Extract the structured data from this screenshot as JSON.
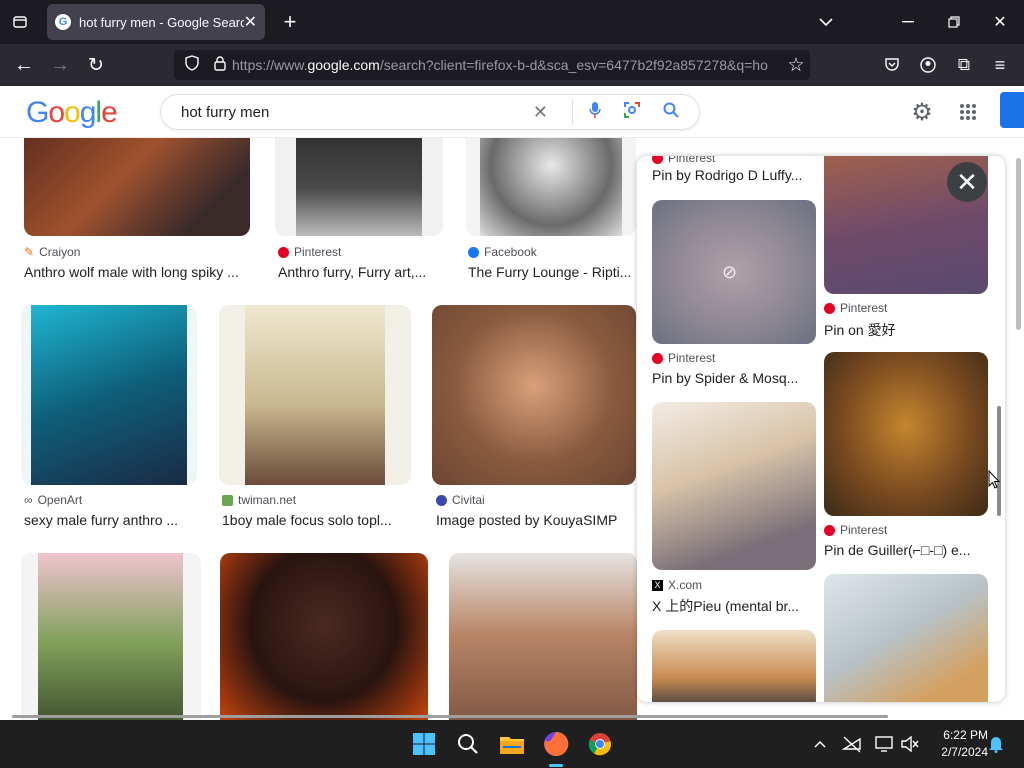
{
  "browser": {
    "tab_title": "hot furry men - Google Search",
    "url_prefix": "https://www.",
    "url_host": "google.com",
    "url_rest": "/search?client=firefox-b-d&sca_esv=6477b2f92a857278&q=ho"
  },
  "google": {
    "logo": "Google",
    "query": "hot furry men",
    "colors": {
      "blue": "#4285f4",
      "red": "#ea4335",
      "yellow": "#fbbc05",
      "green": "#34a853"
    }
  },
  "results": [
    {
      "source": "Craiyon",
      "caption": "Anthro wolf male with long spiky ..."
    },
    {
      "source": "Pinterest",
      "caption": "Anthro furry, Furry art,..."
    },
    {
      "source": "Facebook",
      "caption": "The Furry Lounge - Ripti..."
    },
    {
      "source": "OpenArt",
      "caption": "sexy male furry anthro ..."
    },
    {
      "source": "twiman.net",
      "caption": "1boy male focus solo topl..."
    },
    {
      "source": "Civitai",
      "caption": "Image posted by KouyaSIMP"
    }
  ],
  "panel": {
    "left": [
      {
        "source": "Pinterest",
        "caption": "Pin by Rodrigo D Luffy..."
      },
      {
        "source": "Pinterest",
        "caption": "Pin by Spider & Mosq..."
      },
      {
        "source": "X.com",
        "caption": "X 上的Pieu (mental br..."
      }
    ],
    "right": [
      {
        "source": "Pinterest",
        "caption": "Pin on 愛好"
      },
      {
        "source": "Pinterest",
        "caption": "Pin de Guiller(⌐□-□) e..."
      }
    ]
  },
  "taskbar": {
    "time": "6:22 PM",
    "date": "2/7/2024"
  }
}
